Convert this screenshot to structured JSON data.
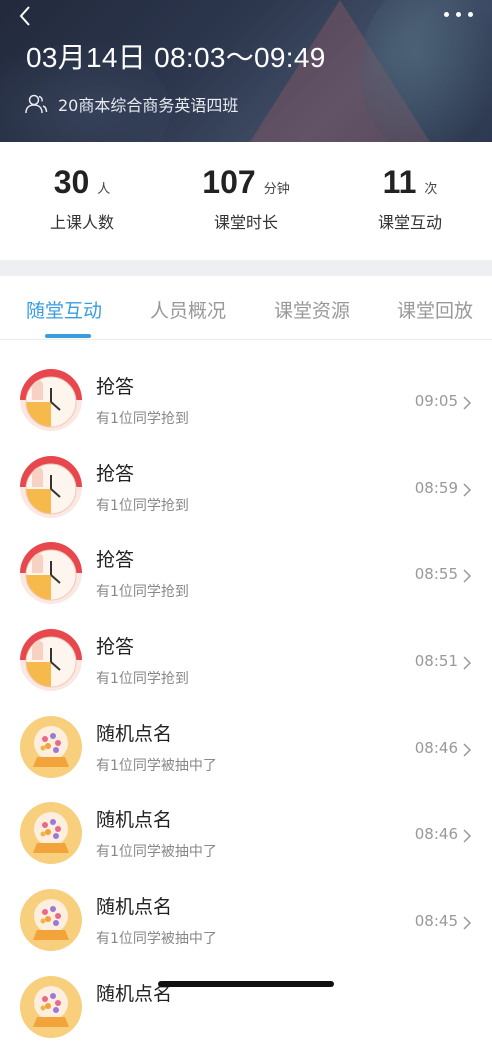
{
  "header": {
    "title": "03月14日 08:03～09:49",
    "class_name": "20商本综合商务英语四班"
  },
  "stats": [
    {
      "value": "30",
      "unit": "人",
      "label": "上课人数"
    },
    {
      "value": "107",
      "unit": "分钟",
      "label": "课堂时长"
    },
    {
      "value": "11",
      "unit": "次",
      "label": "课堂互动"
    }
  ],
  "tabs": [
    {
      "label": "随堂互动",
      "active": true
    },
    {
      "label": "人员概况",
      "active": false
    },
    {
      "label": "课堂资源",
      "active": false
    },
    {
      "label": "课堂回放",
      "active": false
    }
  ],
  "items": [
    {
      "type": "qiangda",
      "title": "抢答",
      "subtitle": "有1位同学抢到",
      "time": "09:05"
    },
    {
      "type": "qiangda",
      "title": "抢答",
      "subtitle": "有1位同学抢到",
      "time": "08:59"
    },
    {
      "type": "qiangda",
      "title": "抢答",
      "subtitle": "有1位同学抢到",
      "time": "08:55"
    },
    {
      "type": "qiangda",
      "title": "抢答",
      "subtitle": "有1位同学抢到",
      "time": "08:51"
    },
    {
      "type": "dianming",
      "title": "随机点名",
      "subtitle": "有1位同学被抽中了",
      "time": "08:46"
    },
    {
      "type": "dianming",
      "title": "随机点名",
      "subtitle": "有1位同学被抽中了",
      "time": "08:46"
    },
    {
      "type": "dianming",
      "title": "随机点名",
      "subtitle": "有1位同学被抽中了",
      "time": "08:45"
    },
    {
      "type": "dianming",
      "title": "随机点名",
      "subtitle": "",
      "time": ""
    }
  ],
  "colors": {
    "accent": "#3a9de0",
    "qiangda_red": "#e6484d",
    "dianming_orange": "#f5b338"
  }
}
